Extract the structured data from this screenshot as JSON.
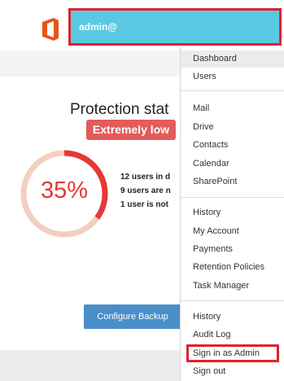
{
  "header": {
    "user": "admin@"
  },
  "protection": {
    "title": "Protection stat",
    "level": "Extremely low",
    "percent": 35,
    "percent_text": "35%",
    "stats": [
      "12 users in d",
      "9 users are n",
      "1 user is not"
    ],
    "configure_button": "Configure Backup"
  },
  "menu": {
    "group1": [
      "Dashboard",
      "Users"
    ],
    "group2": [
      "Mail",
      "Drive",
      "Contacts",
      "Calendar",
      "SharePoint"
    ],
    "group3": [
      "History",
      "My Account",
      "Payments",
      "Retention Policies",
      "Task Manager"
    ],
    "group4": [
      "History",
      "Audit Log",
      "Sign in as Admin",
      "Sign out"
    ]
  },
  "colors": {
    "header_accent": "#5bc8e2",
    "highlight_outline": "#e0212f",
    "badge": "#e45b5b",
    "gauge_fill": "#e53935",
    "gauge_track": "#f2cfc2",
    "button": "#4a8ec9",
    "logo": "#e8541c"
  }
}
